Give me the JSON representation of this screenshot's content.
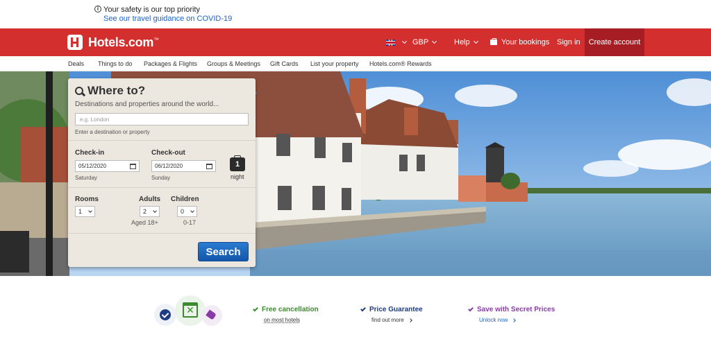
{
  "banner": {
    "line1": "Your safety is our top priority",
    "line2": "See our travel guidance on COVID-19"
  },
  "header": {
    "logo_text": "Hotels.com",
    "logo_tm": "™",
    "currency": "GBP",
    "help": "Help",
    "bookings": "Your bookings",
    "sign_in": "Sign in",
    "create_account": "Create account"
  },
  "subnav": {
    "items": [
      "Deals",
      "Things to do",
      "Packages & Flights",
      "Groups & Meetings",
      "Gift Cards",
      "List your property",
      "Hotels.com® Rewards"
    ]
  },
  "search": {
    "title": "Where to?",
    "subtitle": "Destinations and properties around the world...",
    "destination_placeholder": "e.g. London",
    "destination_hint": "Enter a destination or property",
    "checkin_label": "Check-in",
    "checkin_value": "05/12/2020",
    "checkin_day": "Saturday",
    "checkout_label": "Check-out",
    "checkout_value": "06/12/2020",
    "checkout_day": "Sunday",
    "nights_count": "1",
    "nights_label": "night",
    "rooms_label": "Rooms",
    "rooms_value": "1",
    "adults_label": "Adults",
    "adults_value": "2",
    "adults_note": "Aged 18+",
    "children_label": "Children",
    "children_value": "0",
    "children_note": "0-17",
    "button": "Search"
  },
  "features": [
    {
      "title": "Free cancellation",
      "sub": "on most hotels",
      "color": "#3c8a2e"
    },
    {
      "title": "Price Guarantee",
      "sub": "find out more",
      "color": "#1d3c82"
    },
    {
      "title": "Save with Secret Prices",
      "sub": "Unlock now",
      "color": "#8a3aa6"
    }
  ],
  "colors": {
    "brand_red": "#d32f2f",
    "create_account_bg": "#a61d24",
    "search_button": "#1a62c6"
  }
}
